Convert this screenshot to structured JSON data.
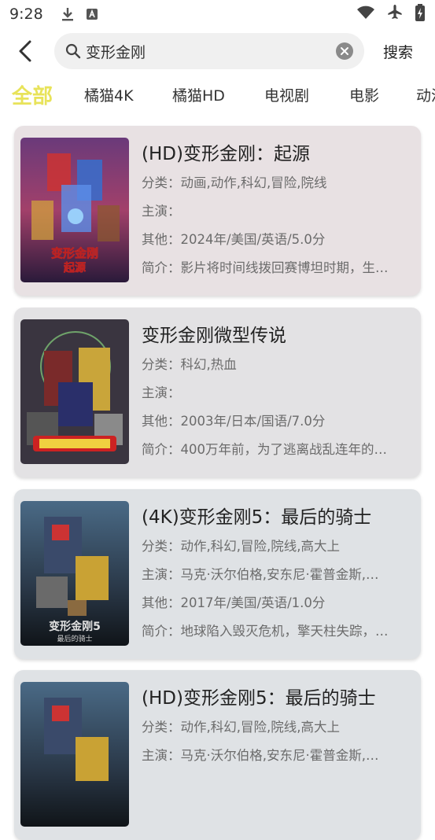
{
  "status": {
    "time": "9:28"
  },
  "search": {
    "value": "变形金刚",
    "button_label": "搜索"
  },
  "tabs": [
    {
      "label": "全部"
    },
    {
      "label": "橘猫4K"
    },
    {
      "label": "橘猫HD"
    },
    {
      "label": "电视剧"
    },
    {
      "label": "电影"
    },
    {
      "label": "动漫"
    }
  ],
  "results": [
    {
      "title": "(HD)变形金刚：起源",
      "category": "分类：动画,动作,科幻,冒险,院线",
      "cast": "主演：",
      "other": "其他：2024年/美国/英语/5.0分",
      "summary": "简介：影片将时间线拨回赛博坦时期，生…",
      "poster_text": "变形金刚\n起源",
      "bg": "#e8e1e3"
    },
    {
      "title": "变形金刚微型传说",
      "category": "分类：科幻,热血",
      "cast": "主演：",
      "other": "其他：2003年/日本/国语/7.0分",
      "summary": "简介：400万年前，为了逃离战乱连年的…",
      "poster_text": "",
      "bg": "#e3e2e4"
    },
    {
      "title": "(4K)变形金刚5：最后的骑士",
      "category": "分类：动作,科幻,冒险,院线,高大上",
      "cast": "主演：马克·沃尔伯格,安东尼·霍普金斯,…",
      "other": "其他：2017年/美国/英语/1.0分",
      "summary": "简介：地球陷入毁灭危机，擎天柱失踪，…",
      "poster_text": "变形金刚5\n最后的骑士",
      "bg": "#dfe2e5"
    },
    {
      "title": "(HD)变形金刚5：最后的骑士",
      "category": "分类：动作,科幻,冒险,院线,高大上",
      "cast": "主演：马克·沃尔伯格,安东尼·霍普金斯,…",
      "other": "",
      "summary": "",
      "poster_text": "",
      "bg": "#dfe2e5"
    }
  ]
}
